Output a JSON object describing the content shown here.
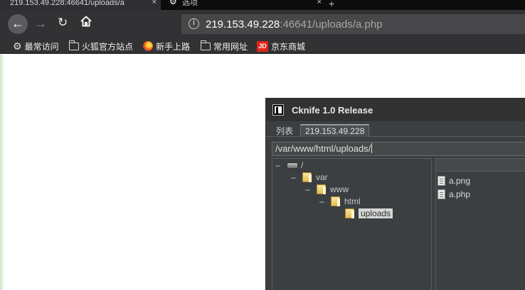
{
  "browser": {
    "tabs": [
      {
        "label": "219.153.49.228:46641/uploads/a"
      },
      {
        "label": "选项"
      }
    ],
    "new_tab_glyph": "+",
    "close_glyph": "×",
    "url": {
      "host": "219.153.49.228",
      "rest": ":46641/uploads/a.php"
    },
    "bookmarks": [
      {
        "label": "最常访问",
        "icon": "gear-icon"
      },
      {
        "label": "火狐官方站点",
        "icon": "folder-icon"
      },
      {
        "label": "新手上路",
        "icon": "firefox-icon"
      },
      {
        "label": "常用网址",
        "icon": "folder-icon"
      },
      {
        "label": "京东商城",
        "icon": "jd-icon",
        "icon_text": "JD"
      }
    ]
  },
  "app": {
    "title": "Cknife 1.0 Release",
    "tabs": [
      {
        "label": "列表"
      },
      {
        "label": "219.153.49.228"
      }
    ],
    "path": "/var/www/html/uploads/",
    "tree": [
      {
        "label": "/",
        "type": "drive"
      },
      {
        "label": "var",
        "type": "folder"
      },
      {
        "label": "www",
        "type": "folder"
      },
      {
        "label": "html",
        "type": "folder"
      },
      {
        "label": "uploads",
        "type": "folder",
        "selected": true
      }
    ],
    "tree_dash": "–",
    "files": [
      {
        "name": "a.png"
      },
      {
        "name": "a.php"
      }
    ]
  }
}
